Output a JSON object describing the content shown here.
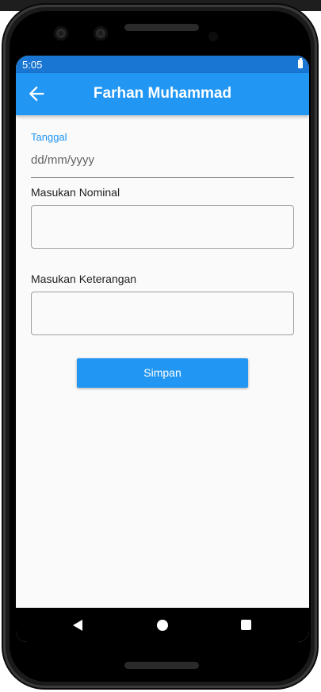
{
  "status_bar": {
    "time": "5:05",
    "battery_icon": "battery-full-icon"
  },
  "app_bar": {
    "title": "Farhan Muhammad",
    "back_icon": "arrow-left-icon",
    "color": "#2196f3"
  },
  "form": {
    "date_label": "Tanggal",
    "date_placeholder": "dd/mm/yyyy",
    "nominal_label": "Masukan Nominal",
    "nominal_value": "",
    "keterangan_label": "Masukan Keterangan",
    "keterangan_value": "",
    "submit_label": "Simpan"
  },
  "nav_bar": {
    "back_icon": "triangle-back-icon",
    "home_icon": "circle-home-icon",
    "recents_icon": "square-recents-icon"
  }
}
